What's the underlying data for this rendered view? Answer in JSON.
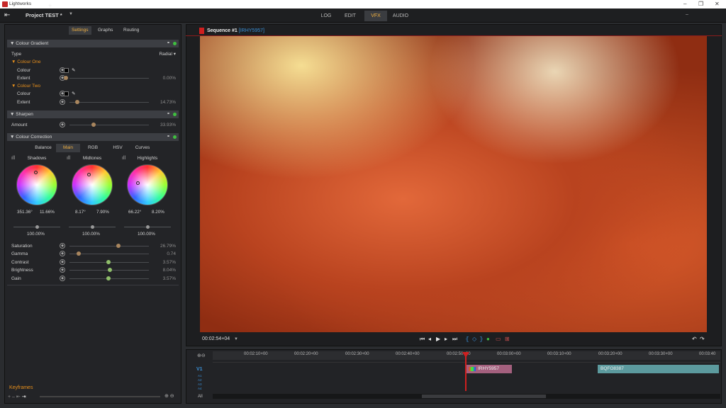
{
  "window": {
    "app_title": "Lightworks"
  },
  "menubar": {
    "project": "Project TEST *",
    "tabs": [
      "LOG",
      "EDIT",
      "VFX",
      "AUDIO"
    ],
    "active_tab": "VFX"
  },
  "panel": {
    "add": "+",
    "tabs": [
      "Settings",
      "Graphs",
      "Routing"
    ],
    "active_tab": "Settings"
  },
  "colour_gradient": {
    "title": "Colour Gradient",
    "type_label": "Type",
    "type_value": "Radial",
    "colour_one": "Colour One",
    "colour_two": "Colour Two",
    "colour_label": "Colour",
    "extent_label": "Extent",
    "extent_one": "0.00%",
    "extent_two": "14.73%"
  },
  "sharpen": {
    "title": "Sharpen",
    "amount_label": "Amount",
    "amount_value": "33.93%"
  },
  "colour_correction": {
    "title": "Colour Correction",
    "tabs": [
      "Balance",
      "Main",
      "RGB",
      "HSV",
      "Curves"
    ],
    "active_tab": "Main",
    "wheels": [
      {
        "label": "Shadows",
        "hue": "351.36°",
        "sat": "11.66%",
        "level": "100.00%"
      },
      {
        "label": "Midtones",
        "hue": "8.17°",
        "sat": "7.90%",
        "level": "100.00%"
      },
      {
        "label": "Highlights",
        "hue": "66.22°",
        "sat": "8.20%",
        "level": "100.00%"
      }
    ],
    "params": [
      {
        "label": "Saturation",
        "value": "26.79%"
      },
      {
        "label": "Gamma",
        "value": "0.74"
      },
      {
        "label": "Contrast",
        "value": "3.57%"
      },
      {
        "label": "Brightness",
        "value": "8.04%"
      },
      {
        "label": "Gain",
        "value": "3.57%"
      }
    ]
  },
  "keyframes": {
    "label": "Keyframes"
  },
  "viewer": {
    "sequence": "Sequence #1",
    "clip": "[IRHY5957]",
    "timecode": "00:02:54+04"
  },
  "timeline": {
    "ticks": [
      "00:02:10+00",
      "00:02:20+00",
      "00:02:30+00",
      "00:02:40+00",
      "00:02:50+00",
      "00:03:00+00",
      "00:03:10+00",
      "00:03:20+00",
      "00:03:30+00",
      "00:03:40"
    ],
    "video_track": "V1",
    "audio_tracks": [
      "A1",
      "A2",
      "A3",
      "A4"
    ],
    "clip1": "IRHY5957",
    "clip2": "BQFO8387",
    "all_label": "All"
  },
  "colors": {
    "accent": "#f0b040",
    "playhead": "#d01f1f",
    "clip1": "#a4607e",
    "clip2": "#5c9a9e",
    "link": "#3a8fd6"
  }
}
